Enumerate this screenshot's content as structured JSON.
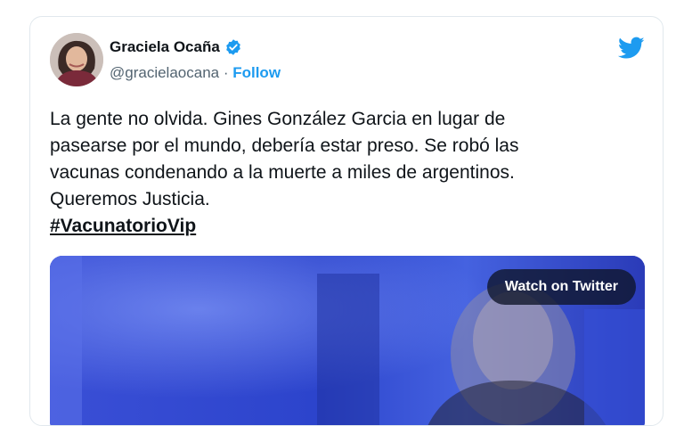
{
  "tweet": {
    "author": {
      "display_name": "Graciela Ocaña",
      "handle": "@gracielaocana",
      "separator": " · ",
      "follow_label": "Follow",
      "verified_icon": "verified-badge-icon"
    },
    "platform_icon": "twitter-bird-icon",
    "text_lines": [
      "La gente no olvida. Gines González Garcia en lugar de",
      "pasearse por el mundo, debería estar preso. Se robó las",
      "vacunas condenando a la muerte a miles de argentinos.",
      "Queremos Justicia."
    ],
    "hashtag": "#VacunatorioVip",
    "media": {
      "watch_label": "Watch on Twitter"
    }
  },
  "colors": {
    "accent": "#1d9bf0",
    "text": "#0f1419",
    "muted": "#536471",
    "video_bg": "#2a3ec0"
  }
}
